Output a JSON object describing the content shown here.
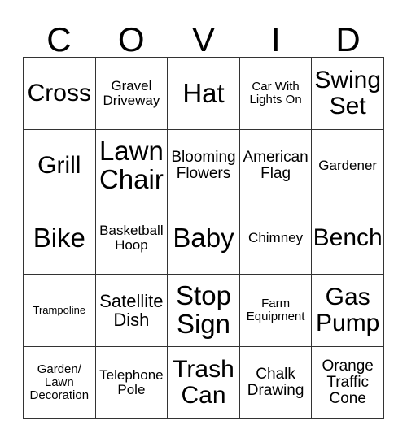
{
  "card": {
    "title_letters": [
      "C",
      "O",
      "V",
      "I",
      "D"
    ],
    "rows": 5,
    "columns": 5,
    "border_color": "#333333",
    "text_color": "#000000",
    "background_color": "#ffffff",
    "cells": [
      {
        "text": "Cross",
        "size": "fs-xxl"
      },
      {
        "text": "Gravel\nDriveway",
        "size": "fs-m"
      },
      {
        "text": "Hat",
        "size": "fs-xxxl"
      },
      {
        "text": "Car With\nLights On",
        "size": "fs-s"
      },
      {
        "text": "Swing\nSet",
        "size": "fs-xxl"
      },
      {
        "text": "Grill",
        "size": "fs-xxl"
      },
      {
        "text": "Lawn\nChair",
        "size": "fs-xxxl"
      },
      {
        "text": "Blooming\nFlowers",
        "size": "fs-ml"
      },
      {
        "text": "American\nFlag",
        "size": "fs-ml"
      },
      {
        "text": "Gardener",
        "size": "fs-m"
      },
      {
        "text": "Bike",
        "size": "fs-xxxl"
      },
      {
        "text": "Basketball\nHoop",
        "size": "fs-m"
      },
      {
        "text": "Baby",
        "size": "fs-xxxl"
      },
      {
        "text": "Chimney",
        "size": "fs-m"
      },
      {
        "text": "Bench",
        "size": "fs-xxl"
      },
      {
        "text": "Trampoline",
        "size": "fs-xs"
      },
      {
        "text": "Satellite\nDish",
        "size": "fs-l"
      },
      {
        "text": "Stop\nSign",
        "size": "fs-xxxl"
      },
      {
        "text": "Farm\nEquipment",
        "size": "fs-s"
      },
      {
        "text": "Gas\nPump",
        "size": "fs-xxl"
      },
      {
        "text": "Garden/\nLawn\nDecoration",
        "size": "fs-s"
      },
      {
        "text": "Telephone\nPole",
        "size": "fs-m"
      },
      {
        "text": "Trash\nCan",
        "size": "fs-xxl"
      },
      {
        "text": "Chalk\nDrawing",
        "size": "fs-ml"
      },
      {
        "text": "Orange\nTraffic\nCone",
        "size": "fs-ml"
      }
    ]
  }
}
